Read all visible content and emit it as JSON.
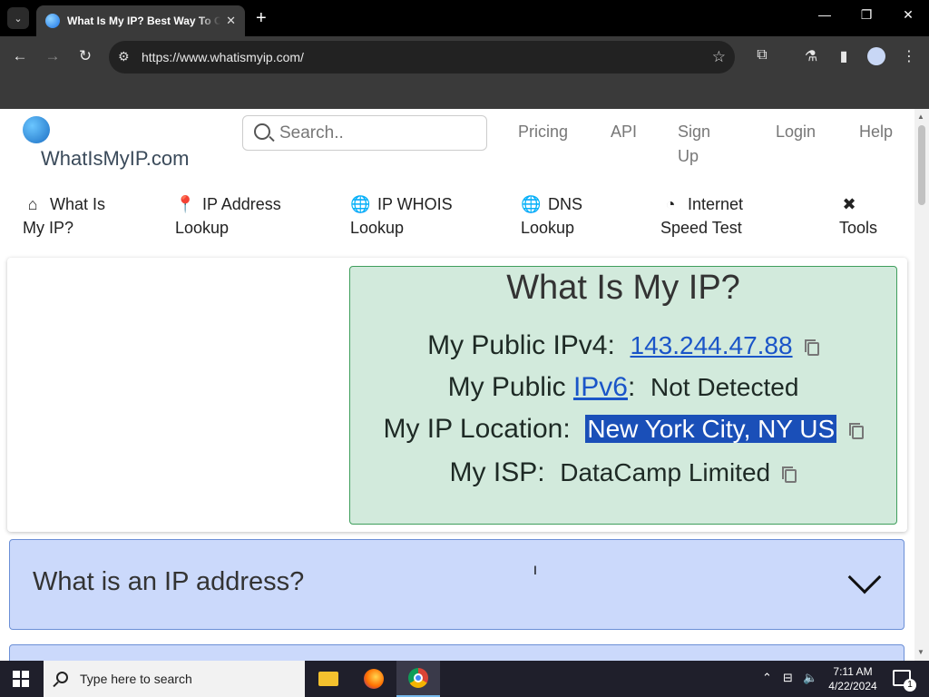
{
  "browser": {
    "tab_title": "What Is My IP? Best Way To Check Your Public IP Address",
    "tab_close": "✕",
    "new_tab": "+",
    "url": "https://www.whatismyip.com/",
    "window_controls": {
      "minimize": "—",
      "maximize": "❐",
      "close": "✕"
    },
    "icons": {
      "back": "←",
      "forward": "→",
      "reload": "↻",
      "bookmark_star": "☆",
      "extensions": "⧉",
      "labs": "⚗",
      "sidepanel": "▮",
      "menu": "⋮",
      "tab_search": "⌄",
      "site_info": "⚙"
    }
  },
  "site": {
    "logo_text": "WhatIsMyIP.com",
    "search_placeholder": "Search..",
    "top_links": [
      "Pricing",
      "API",
      "Sign Up",
      "Login",
      "Help"
    ],
    "nav": [
      {
        "icon": "⌂",
        "label": "What Is My IP?"
      },
      {
        "icon": "📍",
        "label": "IP Address Lookup"
      },
      {
        "icon": "🌐",
        "label": "IP WHOIS Lookup"
      },
      {
        "icon": "🌐",
        "label": "DNS Lookup"
      },
      {
        "icon": "◔",
        "label": "Internet Speed Test"
      },
      {
        "icon": "✖",
        "label": "Tools"
      }
    ]
  },
  "ip_card": {
    "title": "What Is My IP?",
    "ipv4_label": "My Public IPv4:",
    "ipv4_value": "143.244.47.88",
    "ipv6_label_prefix": "My Public ",
    "ipv6_link": "IPv6",
    "ipv6_label_suffix": ":",
    "ipv6_value": "Not Detected",
    "location_label": "My IP Location:",
    "location_value": "New York City, NY US",
    "isp_label": "My ISP:",
    "isp_value": "DataCamp Limited"
  },
  "faq": {
    "q1": "What is an IP address?"
  },
  "taskbar": {
    "search_placeholder": "Type here to search",
    "time": "7:11 AM",
    "date": "4/22/2024",
    "notification_count": "1",
    "tray_icons": {
      "chevron": "⌃",
      "network": "⊟",
      "volume": "🔈"
    }
  }
}
